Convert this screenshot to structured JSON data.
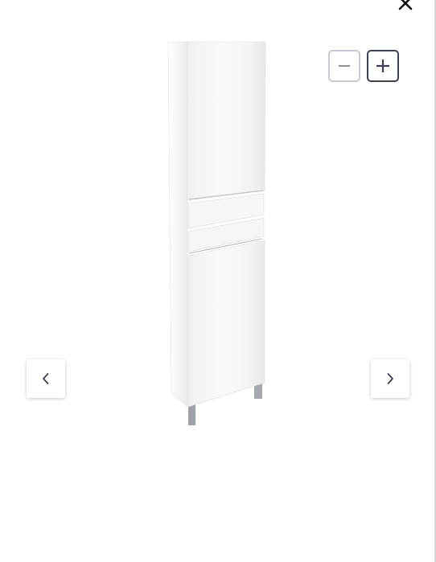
{
  "viewer": {
    "close_icon": "close-icon",
    "zoom_out_icon": "minus-icon",
    "zoom_in_icon": "plus-icon",
    "prev_icon": "chevron-left-icon",
    "next_icon": "chevron-right-icon",
    "product": "tall-bathroom-column-cabinet",
    "colors": {
      "background": "#ffffff",
      "cabinet": "#f4f4f4",
      "legs": "#a5a8ad",
      "zoom_out_border": "#c9c9d3",
      "zoom_in_border": "#3d4150",
      "icon": "#3d4150"
    }
  }
}
